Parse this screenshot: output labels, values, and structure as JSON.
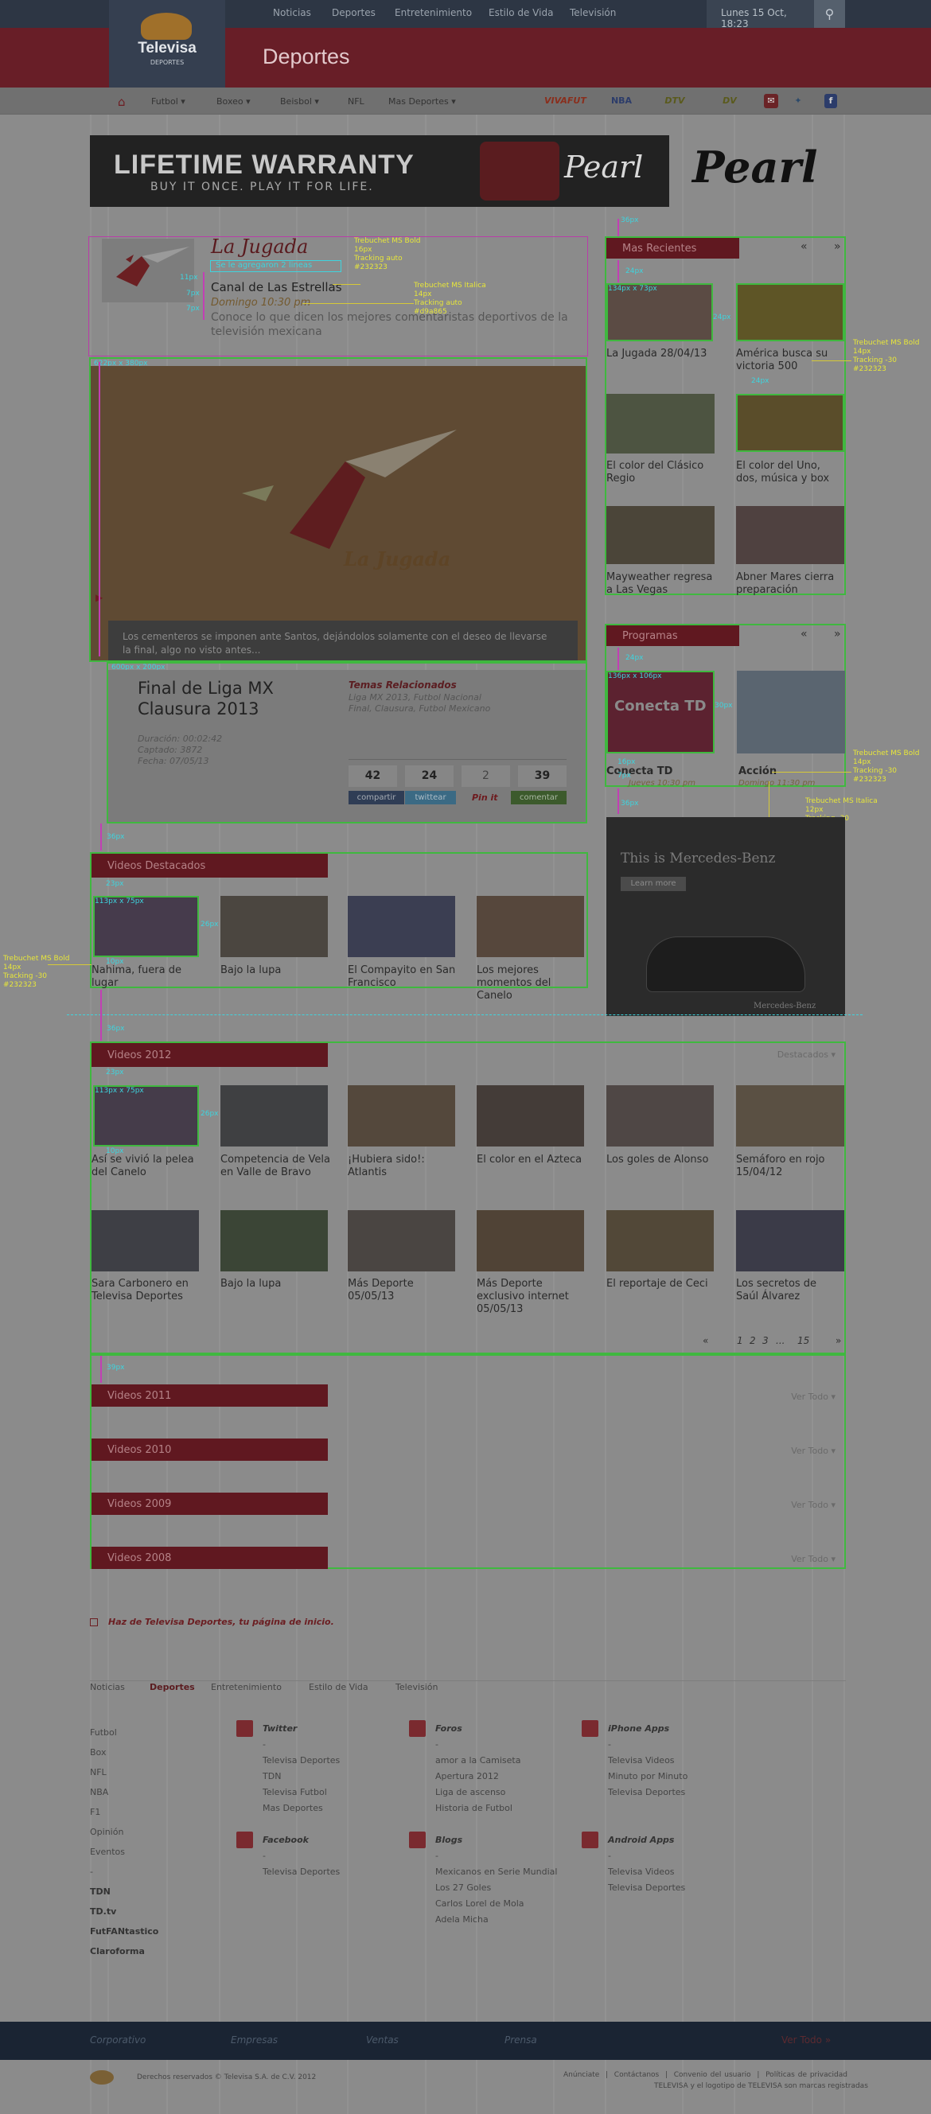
{
  "topnav": {
    "links": [
      "Noticias",
      "Deportes",
      "Entretenimiento",
      "Estilo de Vida",
      "Televisión"
    ],
    "date": "Lunes 15 Oct, 18:23"
  },
  "logo": {
    "name": "Televisa",
    "sub": "DEPORTES"
  },
  "section_title": "Deportes",
  "subnav": {
    "items": [
      "Futbol",
      "Boxeo",
      "Beisbol",
      "NFL",
      "Mas Deportes"
    ],
    "brands": [
      "VIVAFUT",
      "NBA",
      "DTV",
      "DV"
    ]
  },
  "banner": {
    "headline": "LIFETIME WARRANTY",
    "tagline": "BUY IT ONCE.   PLAY IT FOR LIFE.",
    "brand": "Pearl"
  },
  "show": {
    "title": "La Jugada",
    "note": "Se le agregaron 2 lineas",
    "channel": "Canal de Las Estrellas",
    "schedule": "Domingo 10:30 pm",
    "desc_line1": "Conoce lo que dicen los mejores comentaristas deportivos de la",
    "desc_line2": "televisión mexicana"
  },
  "annotations": {
    "show_title": "Trebuchet MS Bold\n16px\nTracking auto\n#232323",
    "show_schedule": "Trebuchet MS Italica\n14px\nTracking auto\n#d9a865",
    "recent_caption": "Trebuchet MS Bold\n14px\nTracking -30\n#232323",
    "program_caption": "Trebuchet MS Bold\n14px\nTracking -30\n#232323",
    "program_sub": "Trebuchet MS Italica\n12px\nTracking -30\n#d9a865",
    "featured_caption": "Trebuchet MS Bold\n14px\nTracking -30\n#232323"
  },
  "measures": {
    "player": "622px x 380px",
    "info": "600px x 200px",
    "recent_thumb": "134px x 73px",
    "program_thumb": "136px x 106px",
    "small_thumb": "113px x 75px",
    "px11": "11px",
    "px7": "7px",
    "px36": "36px",
    "px24": "24px",
    "px30": "30px",
    "px16": "16px",
    "px23": "23px",
    "px26": "26px",
    "px10": "10px",
    "px39": "39px"
  },
  "video": {
    "title_overlay": "La Jugada",
    "caption": "Los cementeros se imponen ante Santos, dejándolos solamente con el deseo de llevarse la final, algo no visto antes..."
  },
  "info": {
    "title_line1": "Final de Liga MX",
    "title_line2": "Clausura 2013",
    "duration": "Duración: 00:02:42",
    "views": "Captado: 3872",
    "date": "Fecha: 07/05/13",
    "related_title": "Temas Relacionados",
    "related_line1": "Liga MX 2013, Futbol Nacional",
    "related_line2": "Final, Clausura, Futbol Mexicano",
    "counts": [
      "42",
      "24",
      "2",
      "39"
    ],
    "share_labels": [
      "compartir",
      "twittear",
      "Pin it",
      "comentar"
    ]
  },
  "recent": {
    "title": "Mas Recientes",
    "items": [
      "La Jugada 28/04/13",
      "América busca su victoria 500",
      "El color del Clásico Regio",
      "El color del Uno, dos, música y box",
      "Mayweather regresa a Las Vegas",
      "Abner Mares cierra preparación"
    ]
  },
  "programs": {
    "title": "Programas",
    "items": [
      "Conecta TD",
      "Acción"
    ],
    "subs": [
      "Jueves 10:30 pm",
      "Domingo 11:30 pm"
    ]
  },
  "ad_mercedes": {
    "headline": "This is Mercedes-Benz",
    "cta": "Learn more",
    "brand": "Mercedes-Benz"
  },
  "featured": {
    "title": "Videos Destacados",
    "items": [
      "Nahima, fuera de lugar",
      "Bajo la lupa",
      "El Compayito en San Francisco",
      "Los mejores momentos del Canelo"
    ]
  },
  "videos2012": {
    "title": "Videos 2012",
    "filter": "Destacados",
    "row1": [
      "Así se vivió la pelea del Canelo",
      "Competencia de Vela en Valle de Bravo",
      "¡Hubiera sido!: Atlantis",
      "El color en el Azteca",
      "Los goles de Alonso",
      "Semáforo en rojo 15/04/12"
    ],
    "row2": [
      "Sara Carbonero en Televisa Deportes",
      "Bajo la lupa",
      "Más Deporte 05/05/13",
      "Más Deporte exclusivo internet 05/05/13",
      "El reportaje de Ceci",
      "Los secretos de Saúl Álvarez"
    ],
    "pagination": [
      "1",
      "2",
      "3",
      "...",
      "15"
    ]
  },
  "years": [
    {
      "title": "Videos 2011",
      "more": "Ver Todo"
    },
    {
      "title": "Videos 2010",
      "more": "Ver Todo"
    },
    {
      "title": "Videos 2009",
      "more": "Ver Todo"
    },
    {
      "title": "Videos 2008",
      "more": "Ver Todo"
    }
  ],
  "homepage_note": "Haz de Televisa Deportes, tu página de inicio.",
  "footer": {
    "nav": [
      "Noticias",
      "Deportes",
      "Entretenimiento",
      "Estilo de Vida",
      "Televisión"
    ],
    "col1a": [
      "Futbol",
      "Box",
      "NFL",
      "NBA",
      "F1",
      "Opinión",
      "Eventos",
      "-"
    ],
    "col1b": [
      "TDN",
      "TD.tv",
      "FutFANtastico",
      "Claroforma"
    ],
    "twitter_title": "Twitter",
    "twitter": [
      "-",
      "Televisa Deportes",
      "TDN",
      "Televisa Futbol",
      "Mas Deportes"
    ],
    "foros_title": "Foros",
    "foros": [
      "-",
      "amor a la Camiseta",
      "Apertura 2012",
      "Liga de ascenso",
      "Historia de Futbol"
    ],
    "iphone_title": "iPhone Apps",
    "iphone": [
      "-",
      "Televisa Videos",
      "Minuto por Minuto",
      "Televisa Deportes"
    ],
    "facebook_title": "Facebook",
    "facebook": [
      "-",
      "Televisa Deportes"
    ],
    "blogs_title": "Blogs",
    "blogs": [
      "-",
      "Mexicanos en Serie Mundial",
      "Los 27 Goles",
      "Carlos Lorel de Mola",
      "Adela Micha"
    ],
    "android_title": "Android Apps",
    "android": [
      "-",
      "Televisa Videos",
      "Televisa Deportes"
    ]
  },
  "bottombar": {
    "links": [
      "Corporativo",
      "Empresas",
      "Ventas",
      "Prensa"
    ],
    "more": "Ver Todo"
  },
  "legal": {
    "copyright": "Derechos reservados © Televisa S.A. de C.V. 2012",
    "links": [
      "Anúnciate",
      "Contáctanos",
      "Convenio del usuario",
      "Políticas de privacidad"
    ],
    "trademark": "TELEVISA y el logotipo de TELEVISA son marcas registradas"
  }
}
